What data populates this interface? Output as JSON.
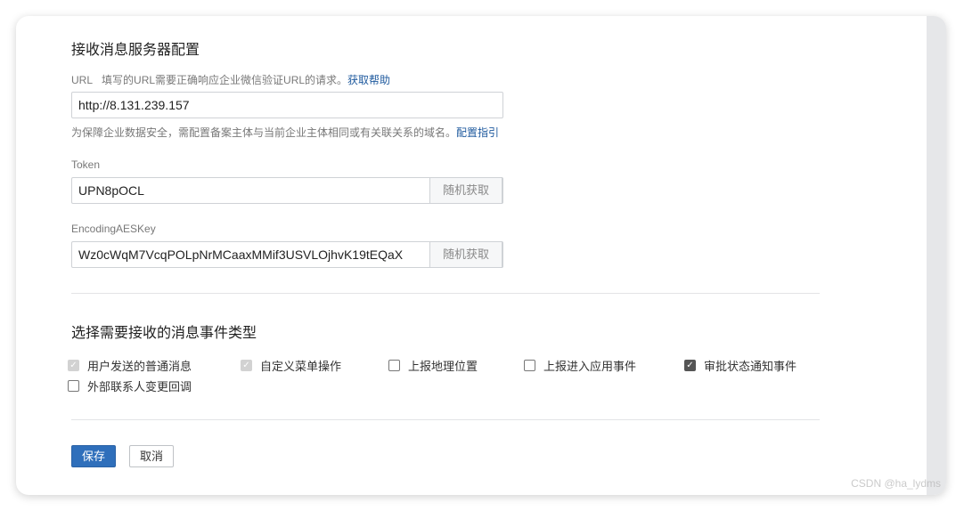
{
  "server": {
    "title": "接收消息服务器配置",
    "url_label": "URL",
    "url_hint": "填写的URL需要正确响应企业微信验证URL的请求。",
    "url_help_link": "获取帮助",
    "url_value": "http://8.131.239.157",
    "domain_hint": "为保障企业数据安全，需配置备案主体与当前企业主体相同或有关联关系的域名。",
    "domain_link": "配置指引",
    "token_label": "Token",
    "token_value": "UPN8pOCL",
    "token_random": "随机获取",
    "aes_label": "EncodingAESKey",
    "aes_value": "Wz0cWqM7VcqPOLpNrMCaaxMMif3USVLOjhvK19tEQaX",
    "aes_random": "随机获取"
  },
  "events": {
    "title": "选择需要接收的消息事件类型",
    "items": [
      {
        "label": "用户发送的普通消息",
        "state": "checked-disabled"
      },
      {
        "label": "自定义菜单操作",
        "state": "checked-disabled"
      },
      {
        "label": "上报地理位置",
        "state": "unchecked"
      },
      {
        "label": "上报进入应用事件",
        "state": "unchecked"
      },
      {
        "label": "审批状态通知事件",
        "state": "checked"
      },
      {
        "label": "外部联系人变更回调",
        "state": "unchecked"
      }
    ]
  },
  "actions": {
    "save": "保存",
    "cancel": "取消"
  },
  "watermark": "CSDN @ha_lydms"
}
